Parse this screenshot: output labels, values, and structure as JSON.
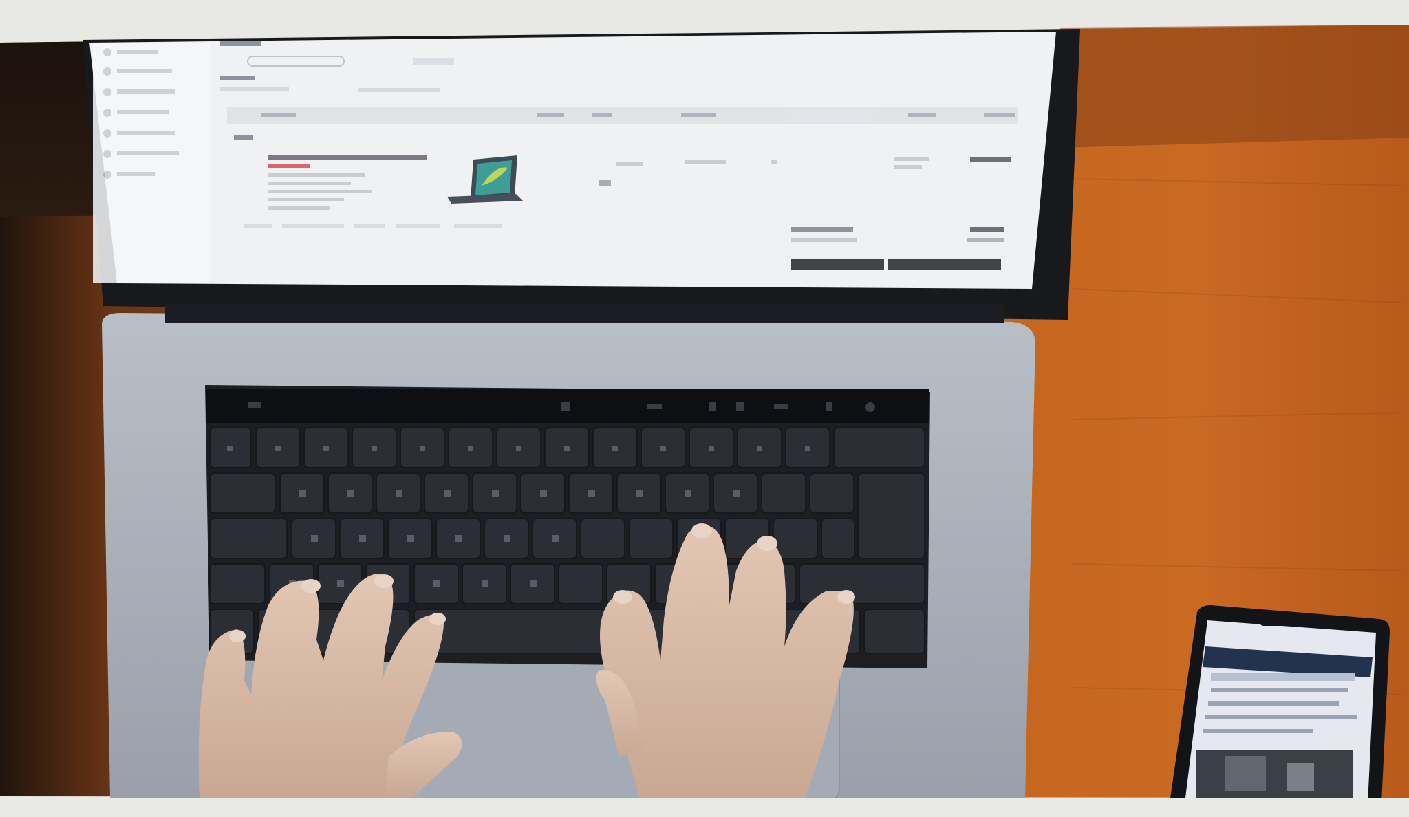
{
  "scene": {
    "description_visible_text": "",
    "colors": {
      "frame_bg": "#e9e9e6",
      "desk_orange": "#c0601c",
      "desk_dark": "#2a1a10",
      "laptop_silver": "#a9afb8",
      "keyboard_dark": "#222428",
      "screen_white": "#f1f2f4",
      "skin": "#d9bca8",
      "phone_black": "#14161a"
    },
    "objects": [
      {
        "name": "laptop",
        "icon": "laptop-icon"
      },
      {
        "name": "left-hand",
        "icon": "hand-icon"
      },
      {
        "name": "right-hand",
        "icon": "hand-icon"
      },
      {
        "name": "smartphone",
        "icon": "phone-icon"
      }
    ]
  }
}
